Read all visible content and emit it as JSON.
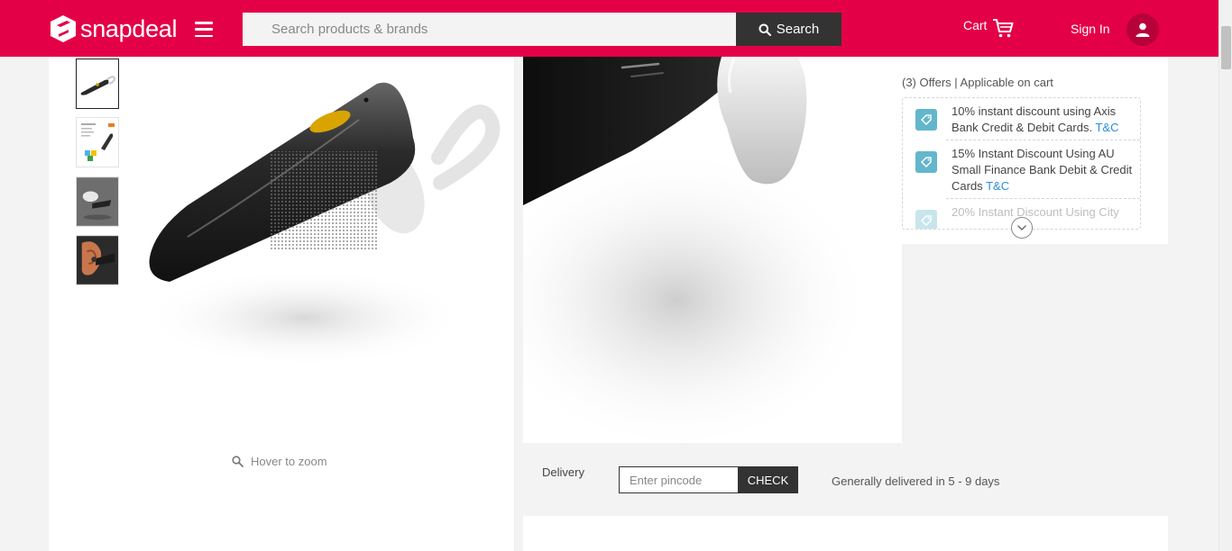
{
  "header": {
    "logo_text": "snapdeal",
    "search_placeholder": "Search products & brands",
    "search_button_label": "Search",
    "cart_label": "Cart",
    "signin_label": "Sign In",
    "brand_color": "#e40046"
  },
  "gallery": {
    "thumbnails": [
      {
        "name": "thumb-1",
        "icon": "headset-black-thumbnail",
        "active": true
      },
      {
        "name": "thumb-2",
        "icon": "headset-infographic-thumbnail",
        "active": false
      },
      {
        "name": "thumb-3",
        "icon": "headset-silver-thumbnail",
        "active": false
      },
      {
        "name": "thumb-4",
        "icon": "headset-in-ear-thumbnail",
        "active": false
      }
    ],
    "hover_hint": "Hover to zoom"
  },
  "offers": {
    "title": "(3) Offers | Applicable on cart",
    "items": [
      {
        "text": "10% instant discount using Axis Bank Credit & Debit Cards.",
        "link": "T&C"
      },
      {
        "text": "15% Instant Discount Using AU Small Finance Bank Debit & Credit Cards",
        "link": "T&C"
      },
      {
        "text": "20% Instant Discount Using City",
        "link": ""
      }
    ]
  },
  "delivery": {
    "label": "Delivery",
    "pincode_placeholder": "Enter pincode",
    "check_label": "CHECK",
    "info": "Generally delivered in 5 - 9 days"
  }
}
